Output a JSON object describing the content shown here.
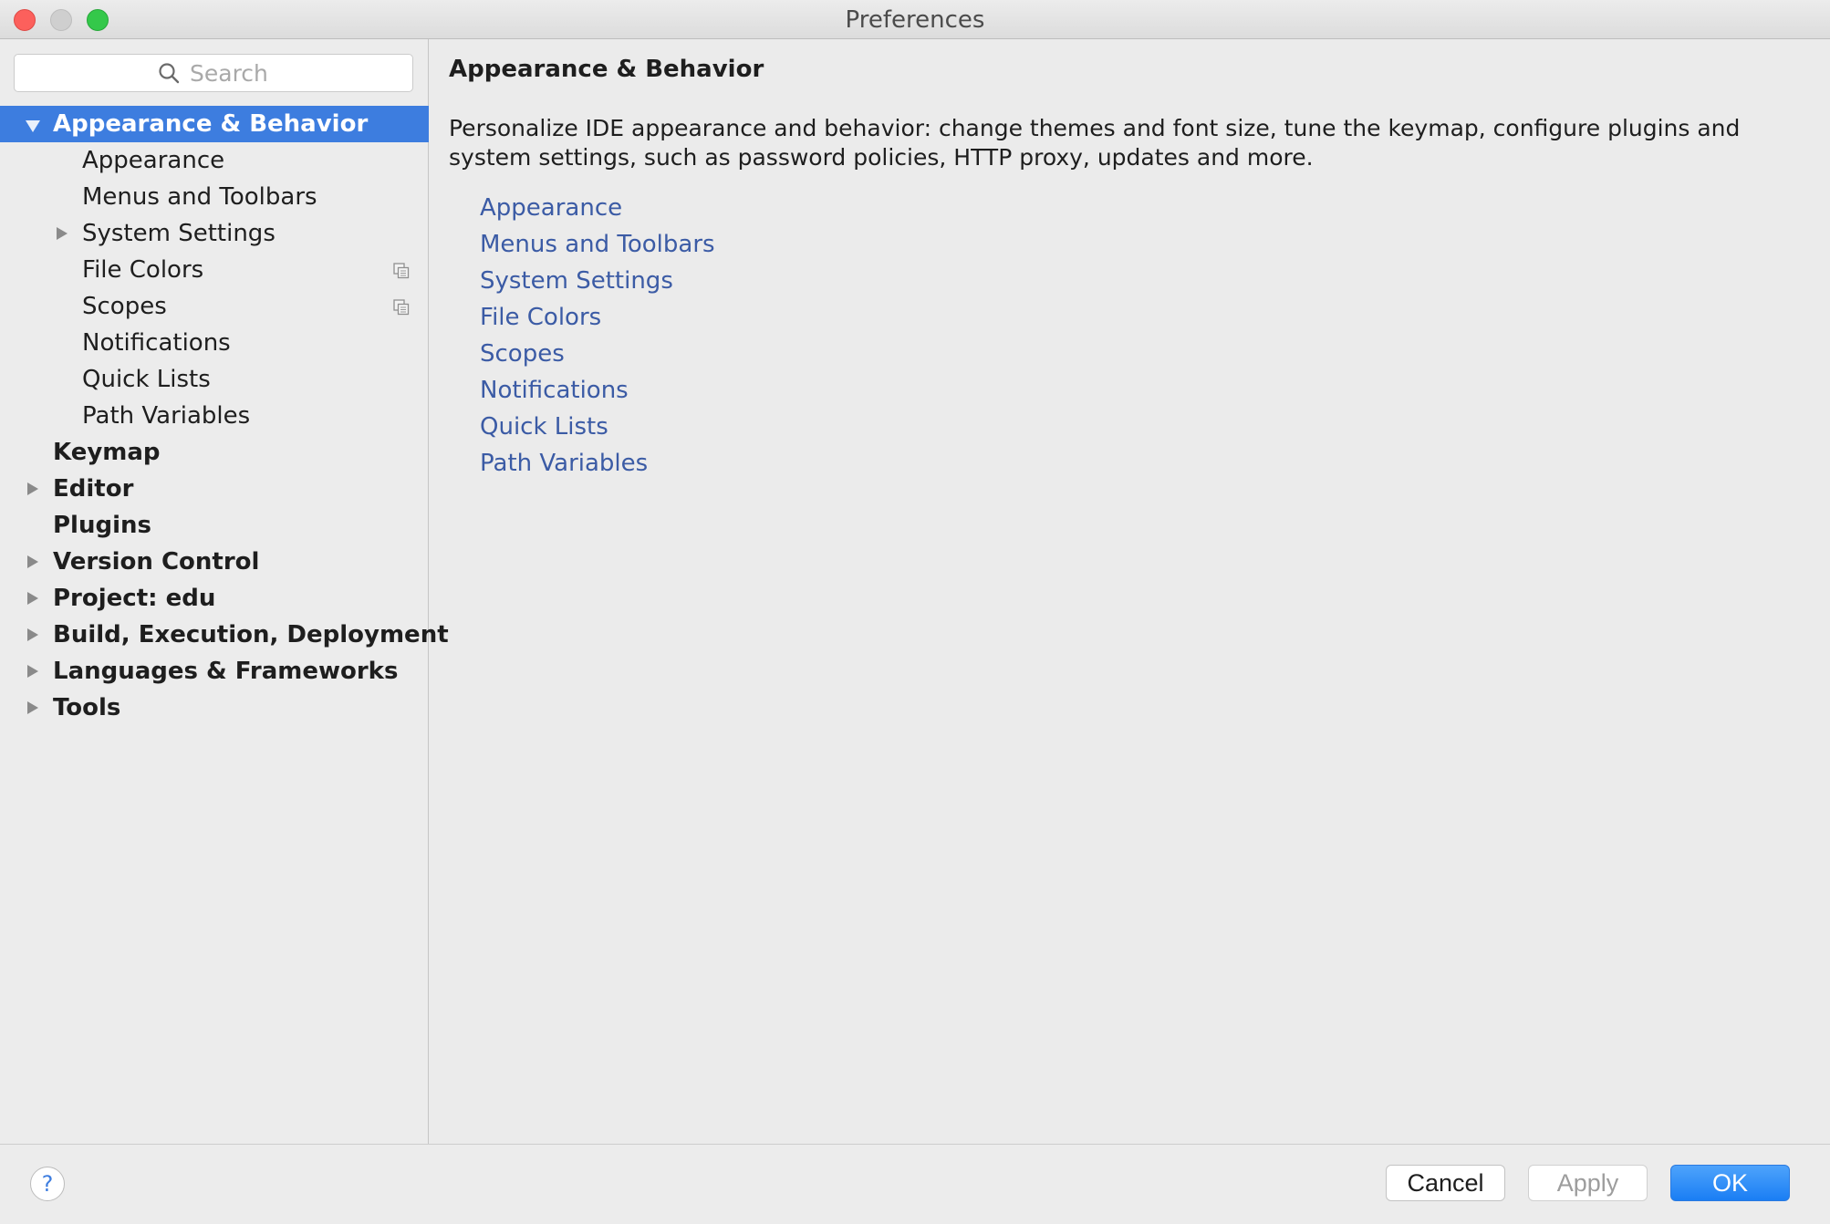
{
  "window": {
    "title": "Preferences"
  },
  "search": {
    "placeholder": "Search",
    "value": ""
  },
  "tree": {
    "appearance_behavior": {
      "label": "Appearance & Behavior",
      "expanded": true,
      "selected": true,
      "children": {
        "appearance": "Appearance",
        "menus_toolbars": "Menus and Toolbars",
        "system_settings": "System Settings",
        "file_colors": "File Colors",
        "scopes": "Scopes",
        "notifications": "Notifications",
        "quick_lists": "Quick Lists",
        "path_variables": "Path Variables"
      }
    },
    "keymap": "Keymap",
    "editor": "Editor",
    "plugins": "Plugins",
    "version_control": "Version Control",
    "project": "Project: edu",
    "build": "Build, Execution, Deployment",
    "languages": "Languages & Frameworks",
    "tools": "Tools"
  },
  "content": {
    "heading": "Appearance & Behavior",
    "description": "Personalize IDE appearance and behavior: change themes and font size, tune the keymap, configure plugins and system settings, such as password policies, HTTP proxy, updates and more.",
    "links": {
      "appearance": "Appearance",
      "menus_toolbars": "Menus and Toolbars",
      "system_settings": "System Settings",
      "file_colors": "File Colors",
      "scopes": "Scopes",
      "notifications": "Notifications",
      "quick_lists": "Quick Lists",
      "path_variables": "Path Variables"
    }
  },
  "footer": {
    "help": "?",
    "cancel": "Cancel",
    "apply": "Apply",
    "ok": "OK"
  },
  "colors": {
    "selection": "#3d7ddf",
    "link": "#3b5ba5",
    "ok_button": "#1a7ef4",
    "close_light": "#fc605c",
    "maximize_light": "#34c84a"
  },
  "icons": {
    "search": "search-icon",
    "expanded": "triangle-down-icon",
    "collapsed": "triangle-right-icon",
    "project_level": "copy-icon"
  }
}
